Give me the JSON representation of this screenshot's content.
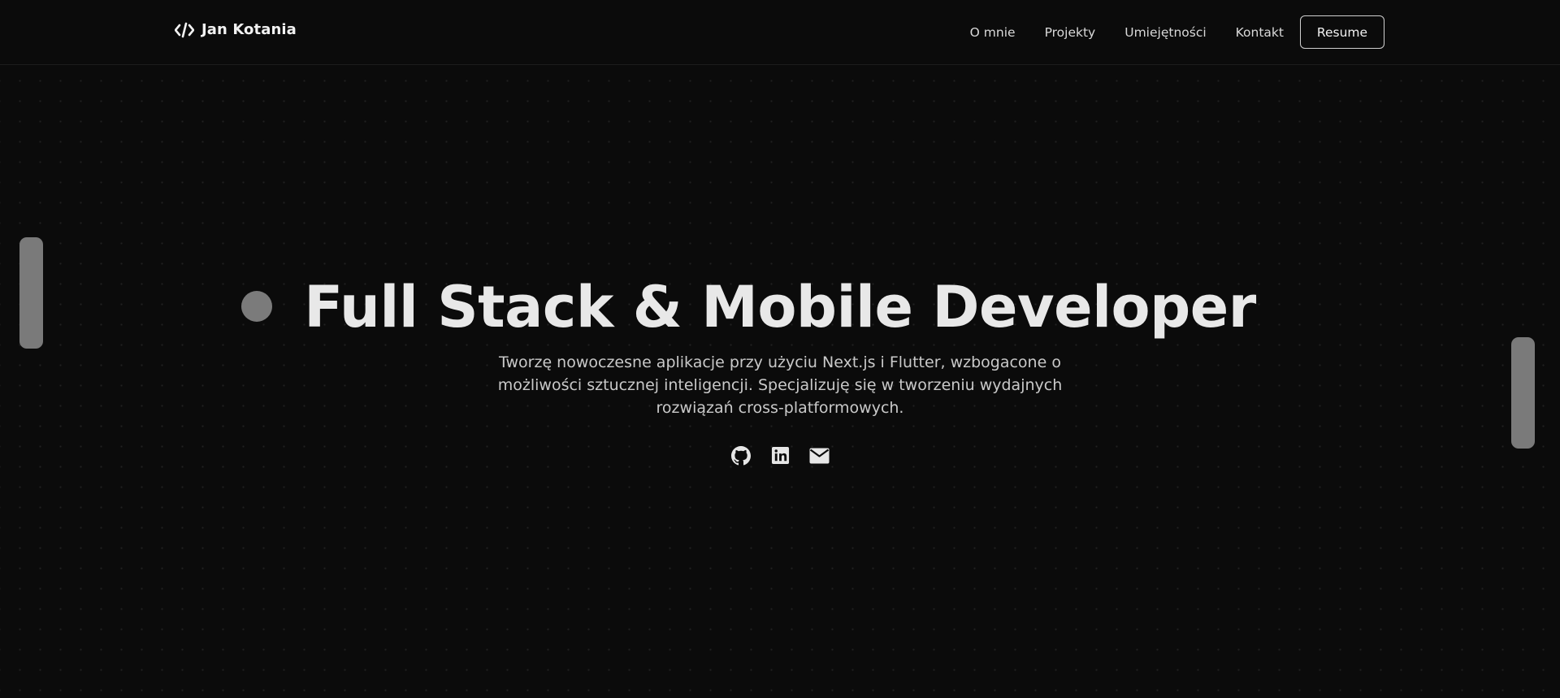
{
  "brand": {
    "icon": "code-icon",
    "name": "Jan Kotania"
  },
  "nav": {
    "items": [
      {
        "label": "O mnie"
      },
      {
        "label": "Projekty"
      },
      {
        "label": "Umiejętności"
      },
      {
        "label": "Kontakt"
      }
    ],
    "resume_label": "Resume"
  },
  "hero": {
    "title": "Full Stack & Mobile Developer",
    "subtitle": "Tworzę nowoczesne aplikacje przy użyciu Next.js i Flutter, wzbogacone o możliwości sztucznej inteligencji. Specjalizuję się w tworzeniu wydajnych rozwiązań cross-platformowych."
  },
  "socials": [
    {
      "icon": "github-icon"
    },
    {
      "icon": "linkedin-icon"
    },
    {
      "icon": "mail-icon"
    }
  ],
  "colors": {
    "background": "#0b0b0b",
    "text": "#e8e8e8",
    "muted_text": "#c9c9c9",
    "decoration": "#7a7a7a"
  }
}
